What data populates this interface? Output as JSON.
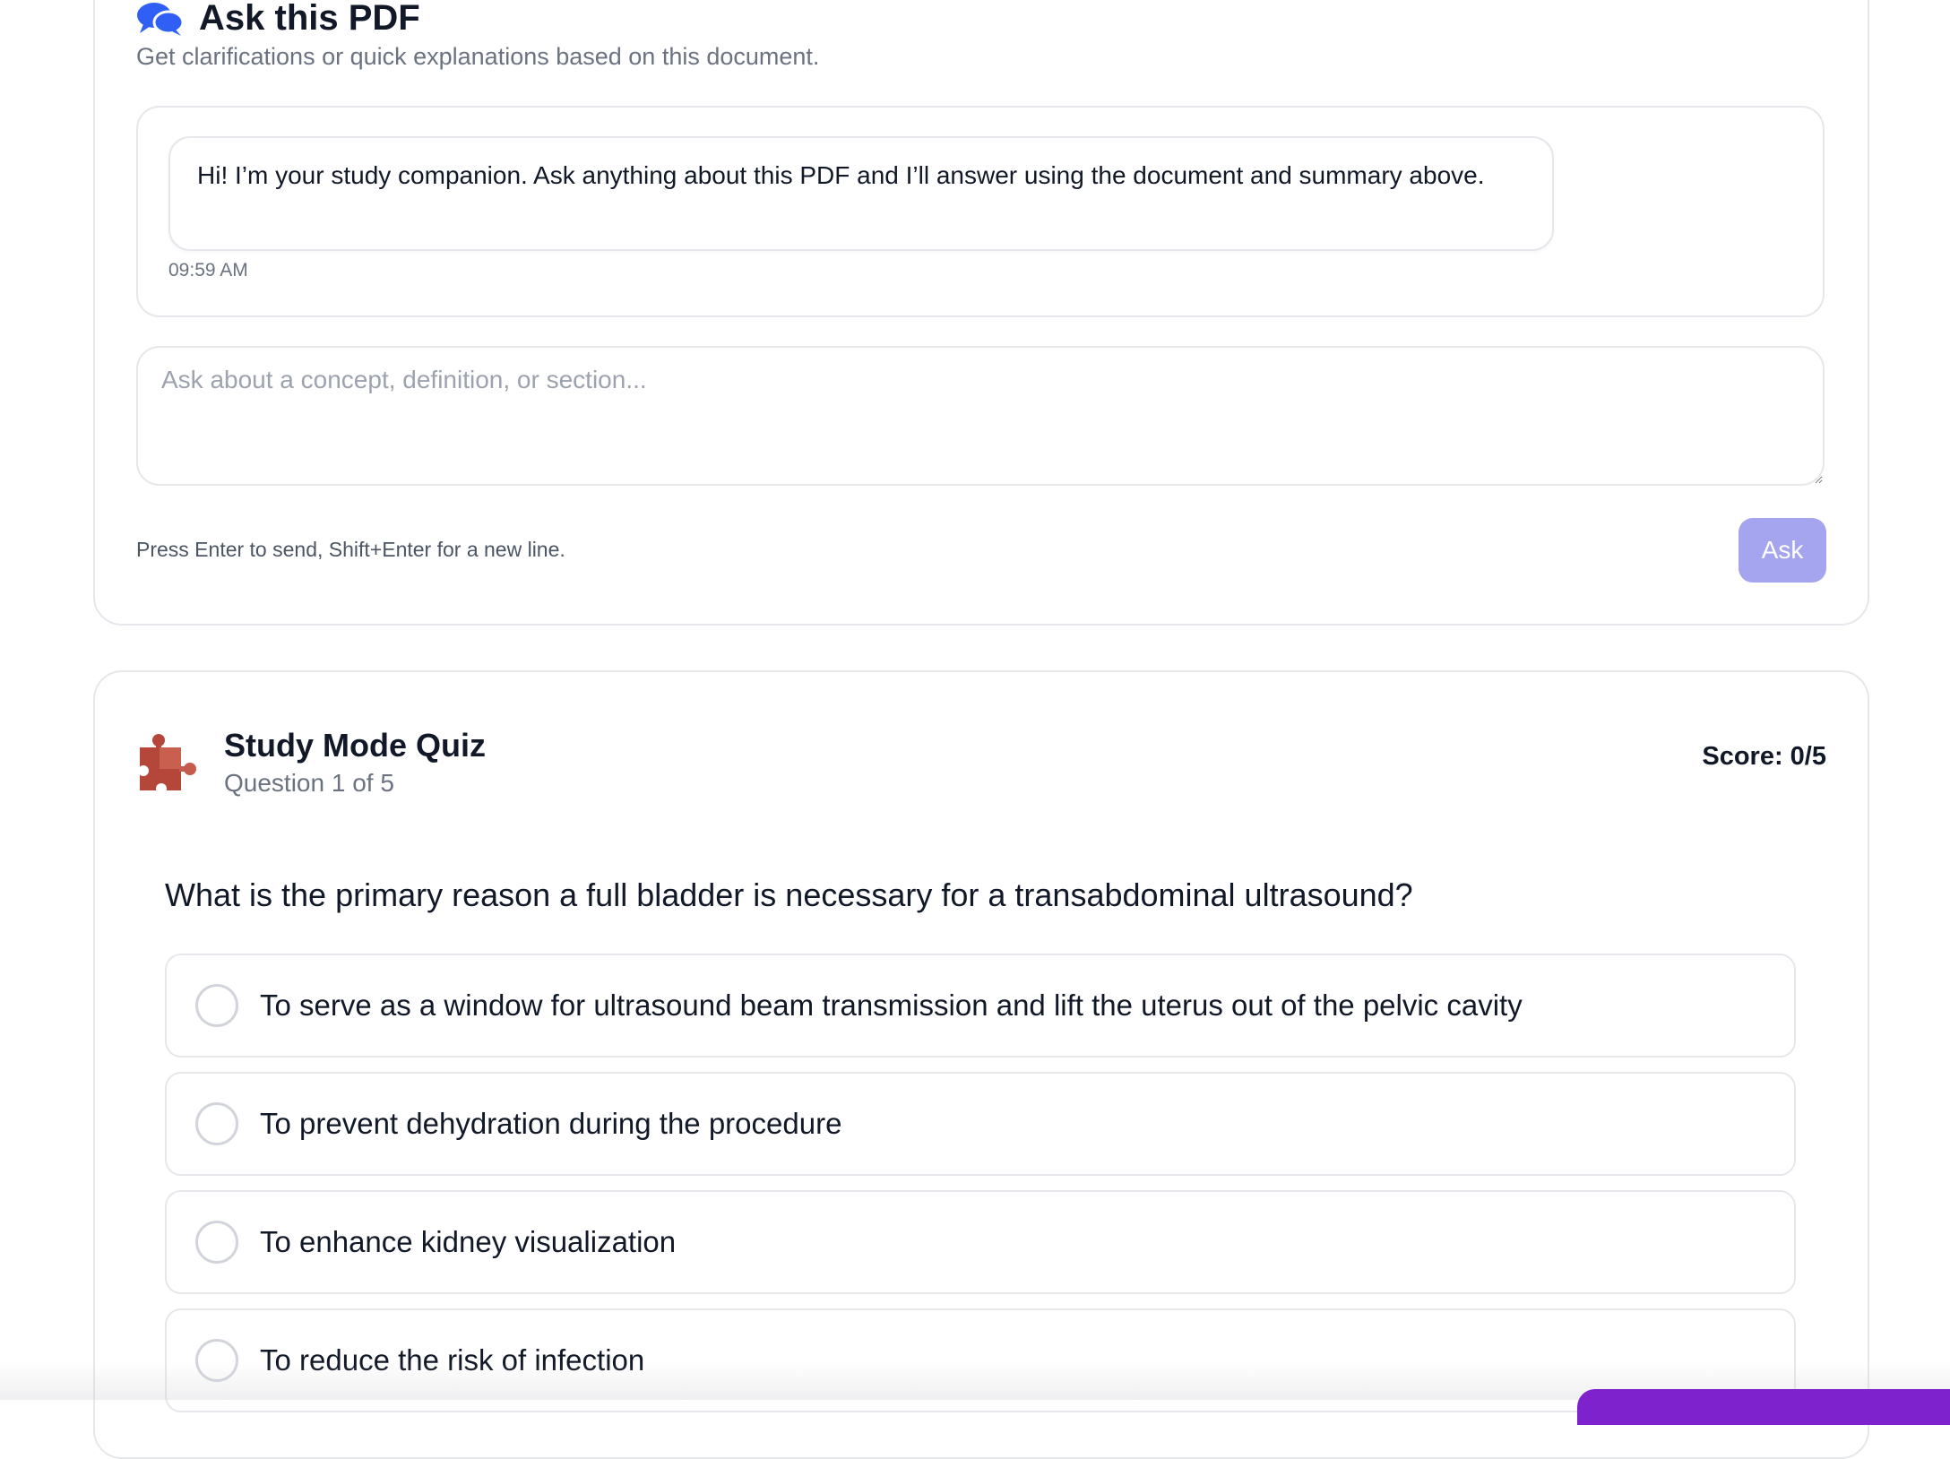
{
  "ask": {
    "title": "Ask this PDF",
    "subtitle": "Get clarifications or quick explanations based on this document.",
    "message": "Hi! I’m your study companion. Ask anything about this PDF and I’ll answer using the document and summary above.",
    "timestamp": "09:59 AM",
    "input_placeholder": "Ask about a concept, definition, or section...",
    "hint": "Press Enter to send, Shift+Enter for a new line.",
    "button_label": "Ask",
    "icon": "chat-bubbles-icon",
    "colors": {
      "icon": "#2f5ff5",
      "button": "#a5a4ee"
    }
  },
  "quiz": {
    "title": "Study Mode Quiz",
    "progress": "Question 1 of 5",
    "score": "Score: 0/5",
    "icon": "puzzle-piece-icon",
    "question": "What is the primary reason a full bladder is necessary for a transabdominal ultrasound?",
    "options": [
      {
        "label": "To serve as a window for ultrasound beam transmission and lift the uterus out of the pelvic cavity"
      },
      {
        "label": "To prevent dehydration during the procedure"
      },
      {
        "label": "To enhance kidney visualization"
      },
      {
        "label": "To reduce the risk of infection"
      }
    ],
    "colors": {
      "icon": "#b5473a"
    }
  }
}
